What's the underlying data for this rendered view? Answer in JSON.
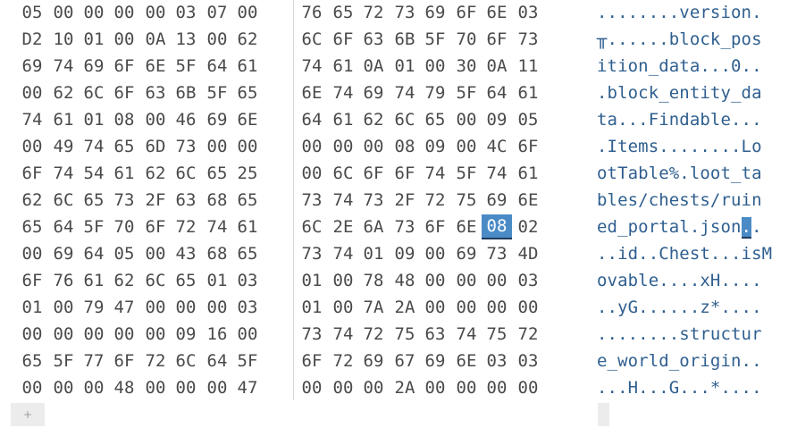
{
  "hex_rows": [
    [
      "05",
      "00",
      "00",
      "00",
      "00",
      "03",
      "07",
      "00",
      "76",
      "65",
      "72",
      "73",
      "69",
      "6F",
      "6E",
      "03"
    ],
    [
      "D2",
      "10",
      "01",
      "00",
      "0A",
      "13",
      "00",
      "62",
      "6C",
      "6F",
      "63",
      "6B",
      "5F",
      "70",
      "6F",
      "73"
    ],
    [
      "69",
      "74",
      "69",
      "6F",
      "6E",
      "5F",
      "64",
      "61",
      "74",
      "61",
      "0A",
      "01",
      "00",
      "30",
      "0A",
      "11"
    ],
    [
      "00",
      "62",
      "6C",
      "6F",
      "63",
      "6B",
      "5F",
      "65",
      "6E",
      "74",
      "69",
      "74",
      "79",
      "5F",
      "64",
      "61"
    ],
    [
      "74",
      "61",
      "01",
      "08",
      "00",
      "46",
      "69",
      "6E",
      "64",
      "61",
      "62",
      "6C",
      "65",
      "00",
      "09",
      "05"
    ],
    [
      "00",
      "49",
      "74",
      "65",
      "6D",
      "73",
      "00",
      "00",
      "00",
      "00",
      "00",
      "08",
      "09",
      "00",
      "4C",
      "6F"
    ],
    [
      "6F",
      "74",
      "54",
      "61",
      "62",
      "6C",
      "65",
      "25",
      "00",
      "6C",
      "6F",
      "6F",
      "74",
      "5F",
      "74",
      "61"
    ],
    [
      "62",
      "6C",
      "65",
      "73",
      "2F",
      "63",
      "68",
      "65",
      "73",
      "74",
      "73",
      "2F",
      "72",
      "75",
      "69",
      "6E"
    ],
    [
      "65",
      "64",
      "5F",
      "70",
      "6F",
      "72",
      "74",
      "61",
      "6C",
      "2E",
      "6A",
      "73",
      "6F",
      "6E",
      "08",
      "02"
    ],
    [
      "00",
      "69",
      "64",
      "05",
      "00",
      "43",
      "68",
      "65",
      "73",
      "74",
      "01",
      "09",
      "00",
      "69",
      "73",
      "4D"
    ],
    [
      "6F",
      "76",
      "61",
      "62",
      "6C",
      "65",
      "01",
      "03",
      "01",
      "00",
      "78",
      "48",
      "00",
      "00",
      "00",
      "03"
    ],
    [
      "01",
      "00",
      "79",
      "47",
      "00",
      "00",
      "00",
      "03",
      "01",
      "00",
      "7A",
      "2A",
      "00",
      "00",
      "00",
      "00"
    ],
    [
      "00",
      "00",
      "00",
      "00",
      "00",
      "09",
      "16",
      "00",
      "73",
      "74",
      "72",
      "75",
      "63",
      "74",
      "75",
      "72"
    ],
    [
      "65",
      "5F",
      "77",
      "6F",
      "72",
      "6C",
      "64",
      "5F",
      "6F",
      "72",
      "69",
      "67",
      "69",
      "6E",
      "03",
      "03"
    ],
    [
      "00",
      "00",
      "00",
      "48",
      "00",
      "00",
      "00",
      "47",
      "00",
      "00",
      "00",
      "2A",
      "00",
      "00",
      "00",
      "00"
    ]
  ],
  "ascii_rows": [
    "........version.",
    "╥......block_pos",
    "ition_data...0..",
    ".block_entity_da",
    "ta...Findable...",
    ".Items........Lo",
    "otTable%.loot_ta",
    "bles/chests/ruin",
    "ed_portal.json..",
    "..id..Chest...isM",
    "ovable....xH....",
    "..yG......z*....",
    "........structur",
    "e_world_origin..",
    "...H...G...*...."
  ],
  "selection": {
    "row": 8,
    "col": 14,
    "value": "08"
  },
  "add_row_label": "+",
  "colors": {
    "selection_bg": "#4a8bc6",
    "ascii_text": "#2f5f8f",
    "hex_text": "#4a4a4a"
  }
}
